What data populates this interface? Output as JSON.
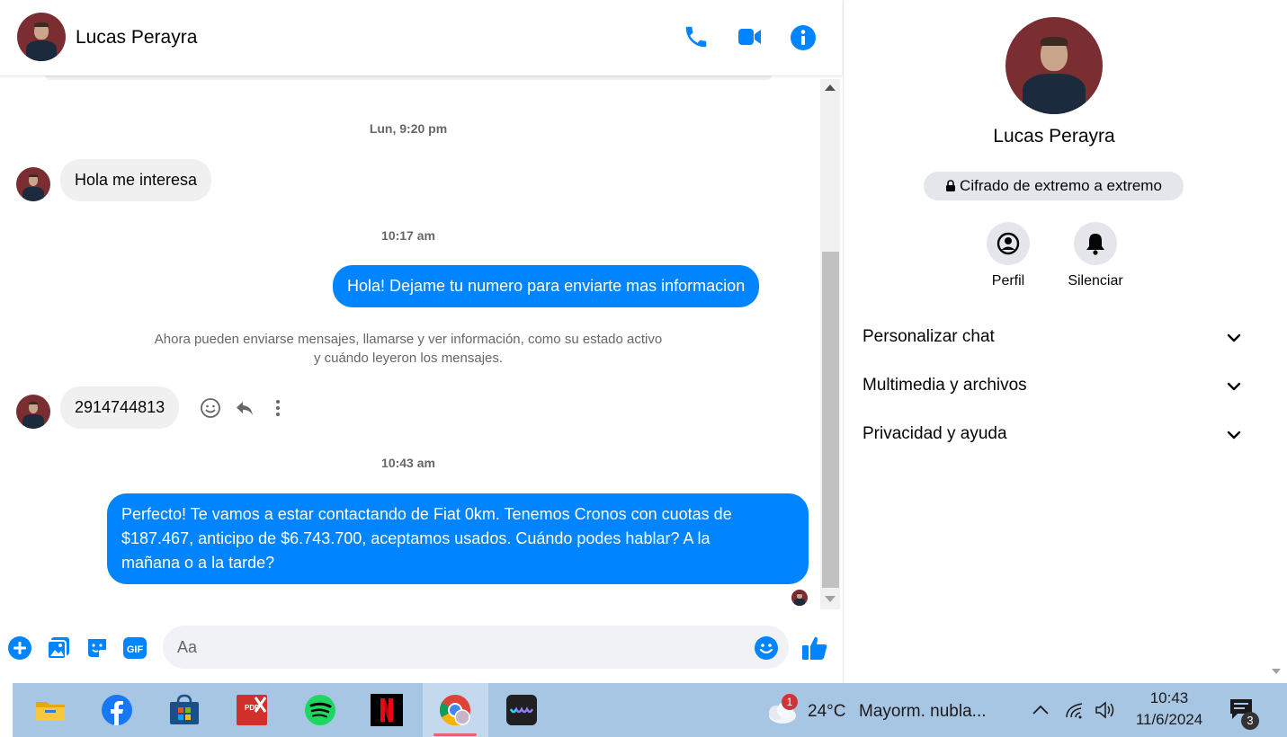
{
  "header": {
    "contact_name": "Lucas Perayra"
  },
  "messages": {
    "timestamp_1": "Lun, 9:20 pm",
    "incoming_1": "Hola me interesa",
    "timestamp_2": "10:17 am",
    "outgoing_1": "Hola! Dejame tu numero para enviarte mas informacion",
    "system_note_line1": "Ahora pueden enviarse mensajes, llamarse y ver información, como su estado activo",
    "system_note_line2": "y cuándo leyeron los mensajes.",
    "incoming_2": "2914744813",
    "timestamp_3": "10:43 am",
    "outgoing_2_line1": "Perfecto! Te vamos a estar contactando de Fiat 0km. Tenemos Cronos con cuotas de",
    "outgoing_2_line2": "$187.467, anticipo de $6.743.700, aceptamos usados. Cuándo podes hablar? A la",
    "outgoing_2_line3": "mañana o a la tarde?"
  },
  "composer": {
    "placeholder": "Aa"
  },
  "right_panel": {
    "name": "Lucas Perayra",
    "encryption_label": "Cifrado de extremo a extremo",
    "actions": [
      {
        "label": "Perfil"
      },
      {
        "label": "Silenciar"
      }
    ],
    "sections": [
      {
        "label": "Personalizar chat"
      },
      {
        "label": "Multimedia y archivos"
      },
      {
        "label": "Privacidad y ayuda"
      }
    ]
  },
  "taskbar": {
    "weather_badge": "1",
    "temperature": "24°C",
    "weather_text": "Mayorm. nubla...",
    "time": "10:43",
    "date": "11/6/2024",
    "notification_count": "3"
  },
  "colors": {
    "messenger_blue": "#0084ff",
    "bubble_gray": "#f0f0f0",
    "taskbar": "#a7c6e4"
  }
}
